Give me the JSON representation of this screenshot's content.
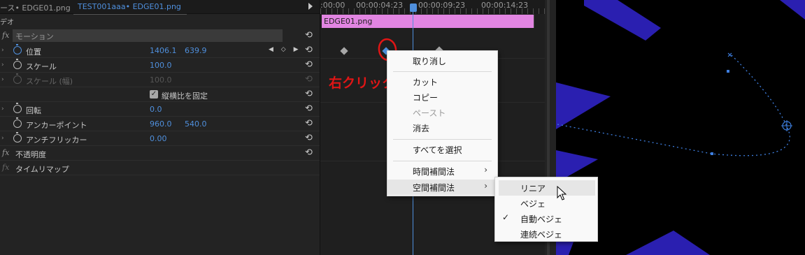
{
  "tabs": {
    "source_tab": "ース• EDGE01.png",
    "active_tab": "TEST001aaa• EDGE01.png"
  },
  "panel": {
    "section_label": "デオ",
    "motion": "モーション",
    "properties": [
      {
        "name": "位置",
        "v1": "1406.1",
        "v2": "639.9"
      },
      {
        "name": "スケール",
        "v1": "100.0"
      },
      {
        "name": "スケール (幅)",
        "v1": "100.0"
      },
      {
        "name": "縦横比を固定"
      },
      {
        "name": "回転",
        "v1": "0.0"
      },
      {
        "name": "アンカーポイント",
        "v1": "960.0",
        "v2": "540.0"
      },
      {
        "name": "アンチフリッカー",
        "v1": "0.00"
      },
      {
        "name": "不透明度"
      },
      {
        "name": "タイムリマップ"
      }
    ],
    "fx_icon": "fx",
    "keyframe_nav": "◀ ◇ ▶",
    "reset_glyph": "⟲"
  },
  "timeline": {
    "timecodes": [
      ":00:00",
      "00:00:04:23",
      "00:00:09:23",
      "00:00:14:23"
    ],
    "clip_label": "EDGE01.png"
  },
  "annotation": "右クリック",
  "context_menu": {
    "items": [
      "取り消し",
      "カット",
      "コピー",
      "ペースト",
      "消去",
      "すべてを選択",
      "時間補間法",
      "空間補間法"
    ],
    "submenu_arrow": "›"
  },
  "submenu": {
    "items": [
      "リニア",
      "ベジェ",
      "自動ベジェ",
      "連続ベジェ"
    ],
    "checked_mark": "✓"
  },
  "colors": {
    "accent_blue": "#4f8fdc",
    "clip_pink": "#e285e2",
    "annotation_red": "#e11515",
    "shape_purple": "#2a1fb0"
  }
}
